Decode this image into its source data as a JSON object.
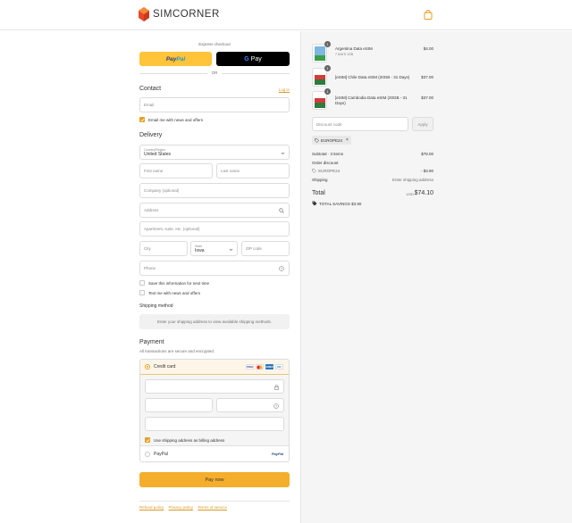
{
  "header": {
    "brand": "SIMCORNER",
    "cart_icon": "shopping-bag-icon",
    "accent": "#e6a023"
  },
  "express": {
    "label": "Express checkout",
    "paypal_part1": "Pay",
    "paypal_part2": "Pal",
    "gpay_g": "G",
    "gpay_text": "Pay",
    "or": "OR"
  },
  "contact": {
    "title": "Contact",
    "login": "Log in",
    "email_placeholder": "Email",
    "news_label": "Email me with news and offers",
    "news_checked": true
  },
  "delivery": {
    "title": "Delivery",
    "country_label": "Country/Region",
    "country_value": "United States",
    "first_name": "First name",
    "last_name": "Last name",
    "company": "Company (optional)",
    "address": "Address",
    "apartment": "Apartment, suite, etc. (optional)",
    "city": "City",
    "state_label": "State",
    "state_value": "Iowa",
    "zip": "ZIP code",
    "phone": "Phone",
    "save_info": "Save this information for next time",
    "text_me": "Text me with news and offers"
  },
  "shipping": {
    "title": "Shipping method",
    "message": "Enter your shipping address to view available shipping methods."
  },
  "payment": {
    "title": "Payment",
    "subtitle": "All transactions are secure and encrypted.",
    "credit_card": "Credit card",
    "cards": [
      "VISA",
      "MC",
      "AMEX",
      "DC"
    ],
    "billing_same": "Use shipping address as billing address",
    "paypal": "PayPal",
    "paypal_logo": "PayPal",
    "pay_now": "Pay now"
  },
  "footer": {
    "links": [
      "Refund policy",
      "Privacy policy",
      "Terms of service"
    ]
  },
  "order": {
    "items": [
      {
        "name": "Argentina Data eSIM",
        "sub": "7 DAYS 1GB",
        "price": "$4.00",
        "qty": "1"
      },
      {
        "name": "[eSIM] Chile Data eSIM (20GB - 31 Days)",
        "sub": "",
        "price": "$37.00",
        "qty": "1"
      },
      {
        "name": "[eSIM] Cambodia Data eSIM (20GB - 31 Days)",
        "sub": "",
        "price": "$37.00",
        "qty": "1"
      }
    ],
    "discount_placeholder": "Discount code",
    "apply": "Apply",
    "applied_code": "EUROPE24",
    "subtotal_label": "Subtotal · 3 items",
    "subtotal": "$78.00",
    "order_discount_label": "Order discount",
    "discount_code": "EUROPE24",
    "discount_value": "- $3.90",
    "shipping_label": "Shipping",
    "shipping_value": "Enter shipping address",
    "total_label": "Total",
    "currency": "USD",
    "total": "$74.10",
    "savings_label": "TOTAL SAVINGS",
    "savings_value": "$3.90"
  }
}
